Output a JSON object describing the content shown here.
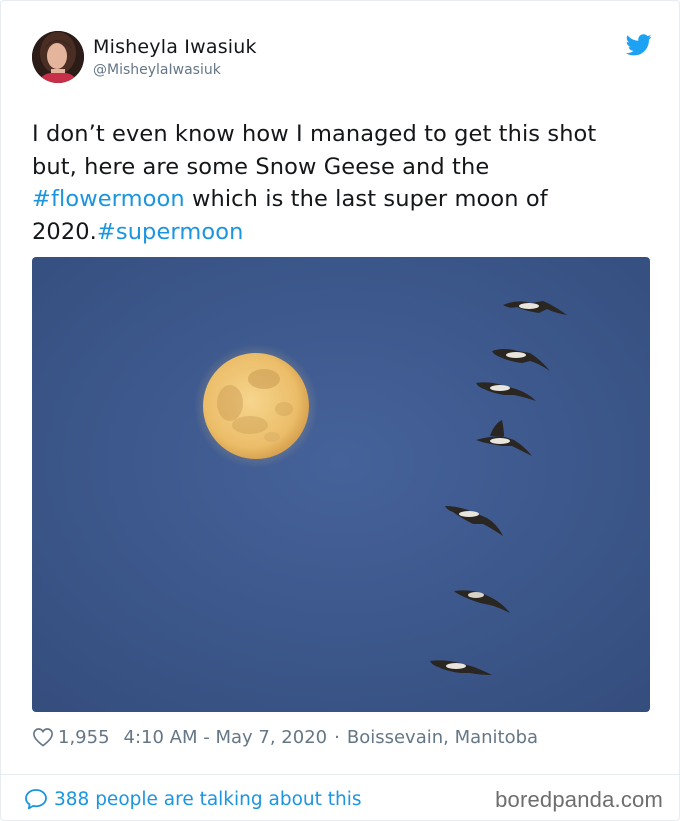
{
  "author": {
    "display_name": "Misheyla Iwasiuk",
    "handle": "@MisheylaIwasiuk"
  },
  "icons": {
    "avatar": "profile-photo",
    "brand": "twitter-bird-icon",
    "like": "heart-icon",
    "conversation": "speech-bubble-icon"
  },
  "tweet": {
    "text_part1": "I don’t even know how I managed to get this shot but, here are some Snow Geese and the ",
    "hashtag1": "#flowermoon",
    "text_part2": " which is the last super moon of 2020.",
    "hashtag2": "#supermoon"
  },
  "photo": {
    "subject": "Full moon with a line of snow geese flying in a blue evening sky"
  },
  "meta": {
    "likes": "1,955",
    "timestamp": "4:10 AM - May 7, 2020",
    "separator": "·",
    "location": "Boissevain, Manitoba"
  },
  "footer": {
    "conversation_label": "388 people are talking about this",
    "watermark": "boredpanda.com"
  },
  "colors": {
    "link": "#1b95e0",
    "muted": "#657786",
    "text": "#14171a",
    "sky": "#3e5a8d",
    "moon": "#f0c778"
  }
}
